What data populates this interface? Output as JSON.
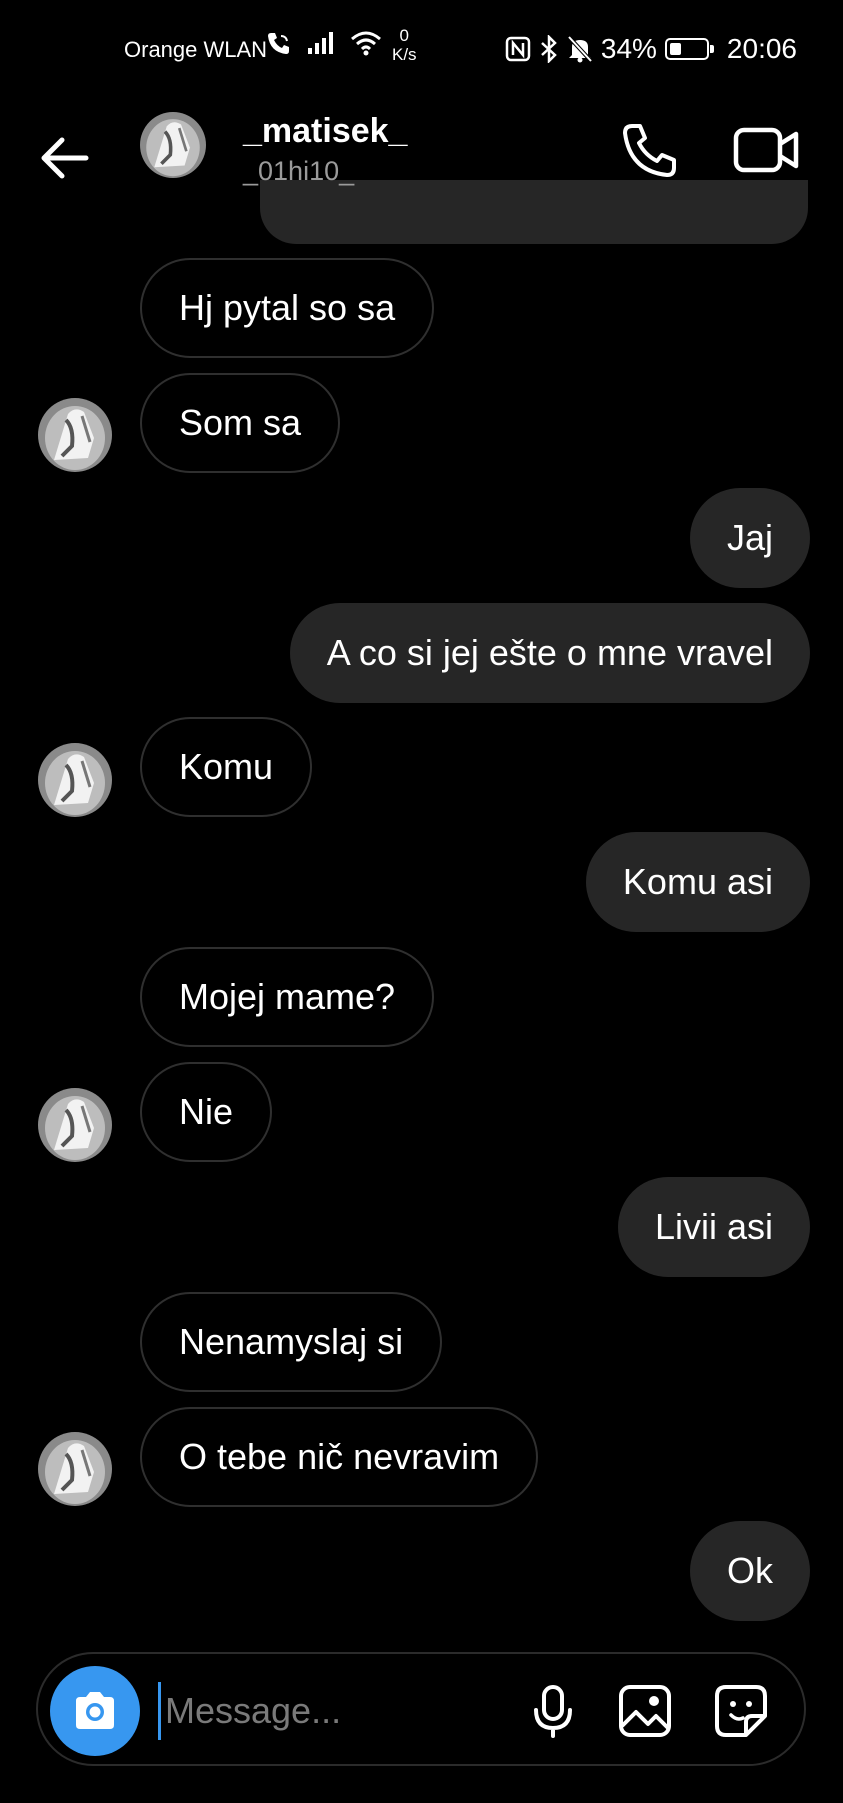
{
  "status_bar": {
    "carrier": "Orange WLAN",
    "speed_value": "0",
    "speed_unit": "K/s",
    "battery": "34%",
    "battery_level": 0.34,
    "time": "20:06",
    "icons": [
      "wifi-call-icon",
      "signal-icon",
      "wifi-icon",
      "nfc-icon",
      "bluetooth-icon",
      "mute-icon",
      "battery-icon"
    ]
  },
  "header": {
    "name": "_matisek_",
    "username": "_01hi10_"
  },
  "messages": [
    {
      "side": "in",
      "text": "Hj pytal so sa"
    },
    {
      "side": "in",
      "text": "Som sa",
      "avatar": true
    },
    {
      "side": "out",
      "text": "Jaj"
    },
    {
      "side": "out",
      "text": "A co si jej ešte o mne vravel"
    },
    {
      "side": "in",
      "text": "Komu",
      "avatar": true
    },
    {
      "side": "out",
      "text": "Komu asi"
    },
    {
      "side": "in",
      "text": "Mojej mame?"
    },
    {
      "side": "in",
      "text": "Nie",
      "avatar": true
    },
    {
      "side": "out",
      "text": "Livii asi"
    },
    {
      "side": "in",
      "text": "Nenamyslaj si"
    },
    {
      "side": "in",
      "text": "O tebe nič  nevravim",
      "avatar": true
    },
    {
      "side": "out",
      "text": "Ok"
    }
  ],
  "composer": {
    "placeholder": "Message..."
  },
  "colors": {
    "accent": "#3797f0",
    "outgoing_bubble": "#262626",
    "incoming_border": "#2f2f2f",
    "background": "#000000"
  }
}
